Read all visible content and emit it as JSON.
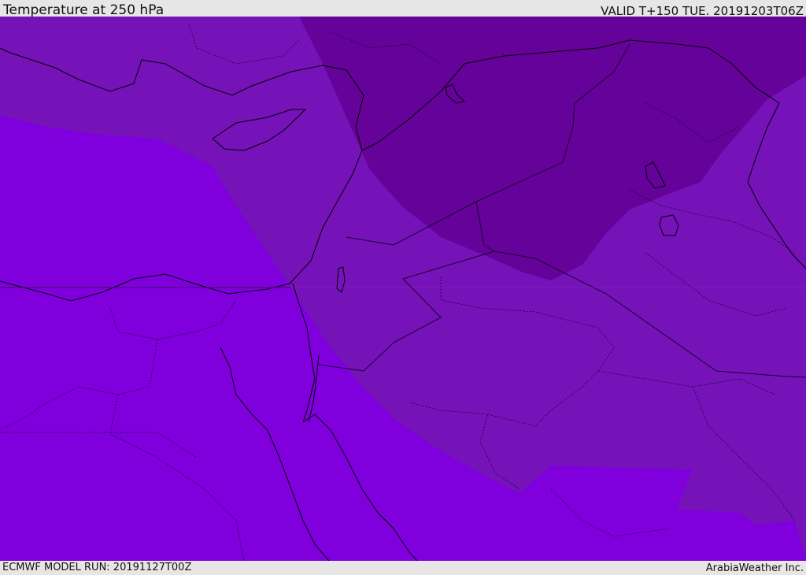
{
  "header": {
    "title": "Temperature at 250 hPa",
    "valid": "VALID T+150 TUE. 20191203T06Z"
  },
  "footer": {
    "model_run": "ECMWF MODEL RUN: 20191127T00Z",
    "credit": "ArabiaWeather Inc."
  },
  "colors": {
    "band_warm": "#7f00dd",
    "band_mid": "#7513b9",
    "band_cold": "#650299",
    "coastline": "#000000",
    "border": "#1a0033"
  }
}
